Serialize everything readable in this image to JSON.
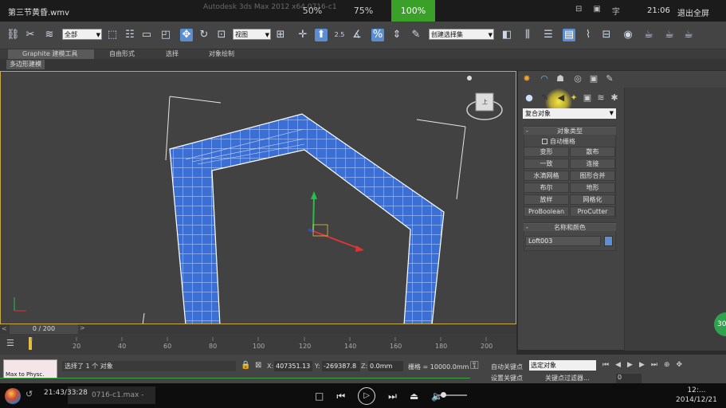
{
  "player": {
    "title": "第三节黄昏.wmv",
    "max_title": "Autodesk 3ds Max 2012 x64    0716-c1",
    "zoom_options": [
      "50%",
      "75%",
      "100%"
    ],
    "tools": [
      "⊟",
      "▣",
      "字"
    ],
    "time": "21:06",
    "fullscreen": "退出全屏"
  },
  "toolbar": {
    "selection_filter": "全部",
    "ref_coord": "视图",
    "spinner_snap": "2.5",
    "percent": "%",
    "named_selection": "创建选择集"
  },
  "ribbon": {
    "tabs": [
      "Graphite 建模工具",
      "自由形式",
      "选择",
      "对象绘制"
    ],
    "sub_tab": "多边形建模"
  },
  "command_panel": {
    "category": "复合对象",
    "object_type_title": "对象类型",
    "auto_grid": "自动栅格",
    "buttons": [
      "变形",
      "散布",
      "一致",
      "连接",
      "水滴网格",
      "图形合并",
      "布尔",
      "地形",
      "放样",
      "网格化",
      "ProBoolean",
      "ProCutter"
    ],
    "name_color_title": "名称和颜色",
    "object_name": "Loft003",
    "swatch_color": "#5d8fd6"
  },
  "timeline": {
    "frame_label": "0 / 200",
    "ticks": [
      "20",
      "40",
      "60",
      "80",
      "100",
      "120",
      "140",
      "160",
      "180",
      "200"
    ]
  },
  "status": {
    "maxscript": "Max to Physc.",
    "message": "选择了 1 个 对象",
    "x_label": "X:",
    "x_value": "407351.13",
    "y_label": "Y:",
    "y_value": "-269387.8",
    "z_label": "Z:",
    "z_value": "0.0mm",
    "grid": "栅格 = 10000.0mm",
    "auto_key": "自动关键点",
    "key_filter": "选定对象",
    "set_key": "设置关键点",
    "key_filters": "关键点过滤器...",
    "frame": "0"
  },
  "taskbar": {
    "elapsed": "21:43/33:28",
    "task": "0716-c1.max - A...",
    "clock_time": "12:...",
    "clock_date": "2014/12/21"
  },
  "badge": "30"
}
